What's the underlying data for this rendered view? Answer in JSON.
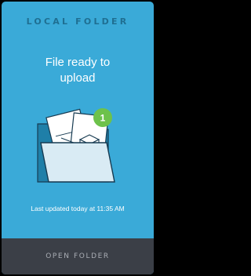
{
  "header": {
    "title": "LOCAL FOLDER"
  },
  "status": {
    "line1": "File ready to",
    "line2": "upload"
  },
  "badge": {
    "count": "1"
  },
  "meta": {
    "last_updated": "Last updated  today at 11:35 AM"
  },
  "footer": {
    "button_label": "OPEN FOLDER"
  },
  "colors": {
    "background": "#3aaad8",
    "title": "#1f6f92",
    "badge": "#6dc24b",
    "footer": "#3b3f47"
  },
  "icons": [
    "folder-icon",
    "document-icon",
    "box-icon",
    "notification-badge"
  ]
}
